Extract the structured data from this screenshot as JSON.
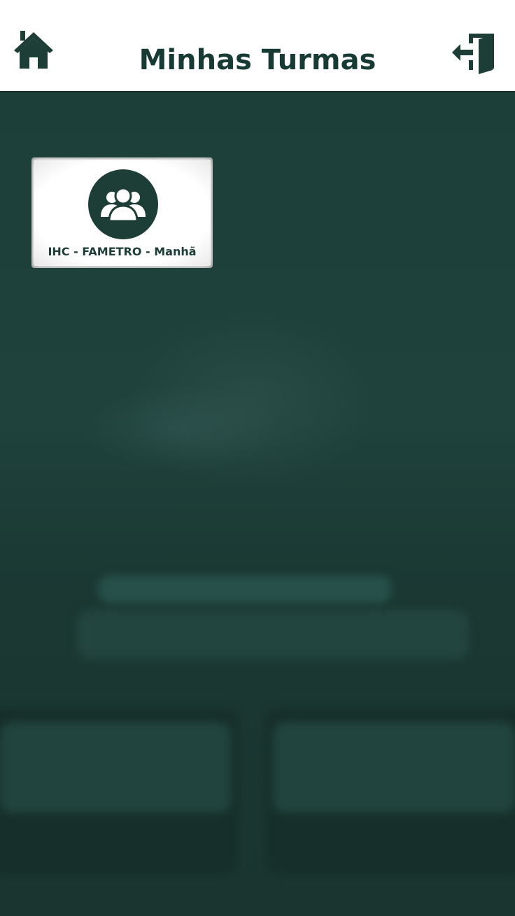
{
  "header": {
    "title": "Minhas Turmas",
    "home_icon": "home-icon",
    "logout_icon": "logout-door-icon"
  },
  "classes": [
    {
      "name": "IHC - FAMETRO - Manhã",
      "icon": "group-users-icon"
    }
  ],
  "colors": {
    "primary": "#1d3d37",
    "header_bg": "#ffffff",
    "background": "#1e3d38"
  }
}
